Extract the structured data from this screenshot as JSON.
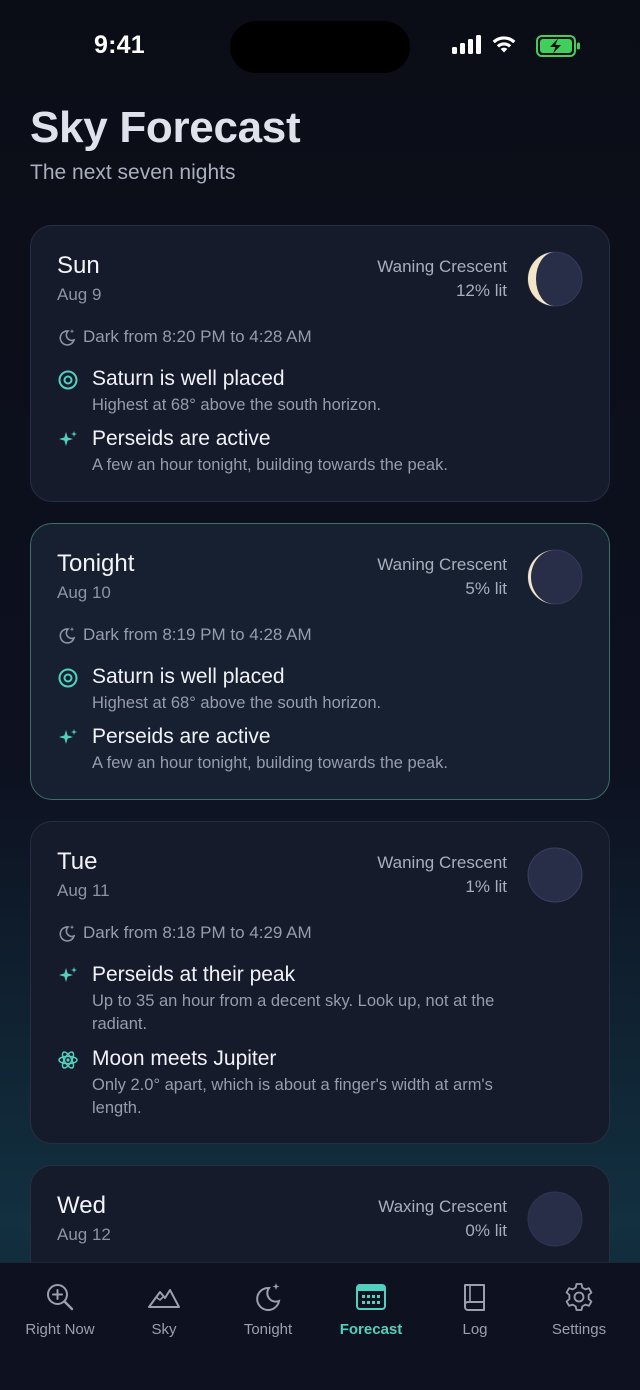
{
  "status": {
    "time": "9:41"
  },
  "header": {
    "title": "Sky Forecast",
    "subtitle": "The next seven nights"
  },
  "days": [
    {
      "day": "Sun",
      "date": "Aug 9",
      "phase": "Waning Crescent",
      "lit": "12% lit",
      "dark": "Dark from 8:20 PM to 4:28 AM",
      "events": [
        {
          "icon": "target-icon",
          "title": "Saturn is well placed",
          "desc": "Highest at 68° above the south horizon."
        },
        {
          "icon": "sparkle-icon",
          "title": "Perseids are active",
          "desc": "A few an hour tonight, building towards the peak."
        }
      ]
    },
    {
      "day": "Tonight",
      "date": "Aug 10",
      "phase": "Waning Crescent",
      "lit": "5% lit",
      "dark": "Dark from 8:19 PM to 4:28 AM",
      "events": [
        {
          "icon": "target-icon",
          "title": "Saturn is well placed",
          "desc": "Highest at 68° above the south horizon."
        },
        {
          "icon": "sparkle-icon",
          "title": "Perseids are active",
          "desc": "A few an hour tonight, building towards the peak."
        }
      ]
    },
    {
      "day": "Tue",
      "date": "Aug 11",
      "phase": "Waning Crescent",
      "lit": "1% lit",
      "dark": "Dark from 8:18 PM to 4:29 AM",
      "events": [
        {
          "icon": "sparkle-icon",
          "title": "Perseids at their peak",
          "desc": "Up to 35 an hour from a decent sky. Look up, not at the radiant."
        },
        {
          "icon": "atom-icon",
          "title": "Moon meets Jupiter",
          "desc": "Only 2.0° apart, which is about a finger's width at arm's length."
        }
      ]
    },
    {
      "day": "Wed",
      "date": "Aug 12",
      "phase": "Waxing Crescent",
      "lit": "0% lit"
    }
  ],
  "tabs": [
    {
      "label": "Right Now",
      "icon": "magnifier-plus-icon"
    },
    {
      "label": "Sky",
      "icon": "mountains-icon"
    },
    {
      "label": "Tonight",
      "icon": "moon-stars-icon"
    },
    {
      "label": "Forecast",
      "icon": "calendar-icon"
    },
    {
      "label": "Log",
      "icon": "book-icon"
    },
    {
      "label": "Settings",
      "icon": "gear-icon"
    }
  ],
  "colors": {
    "accent": "#4fd1bd",
    "card": "#161b2c",
    "active_border": "#3a6f6a",
    "moonlight": "#f2e6c4"
  }
}
